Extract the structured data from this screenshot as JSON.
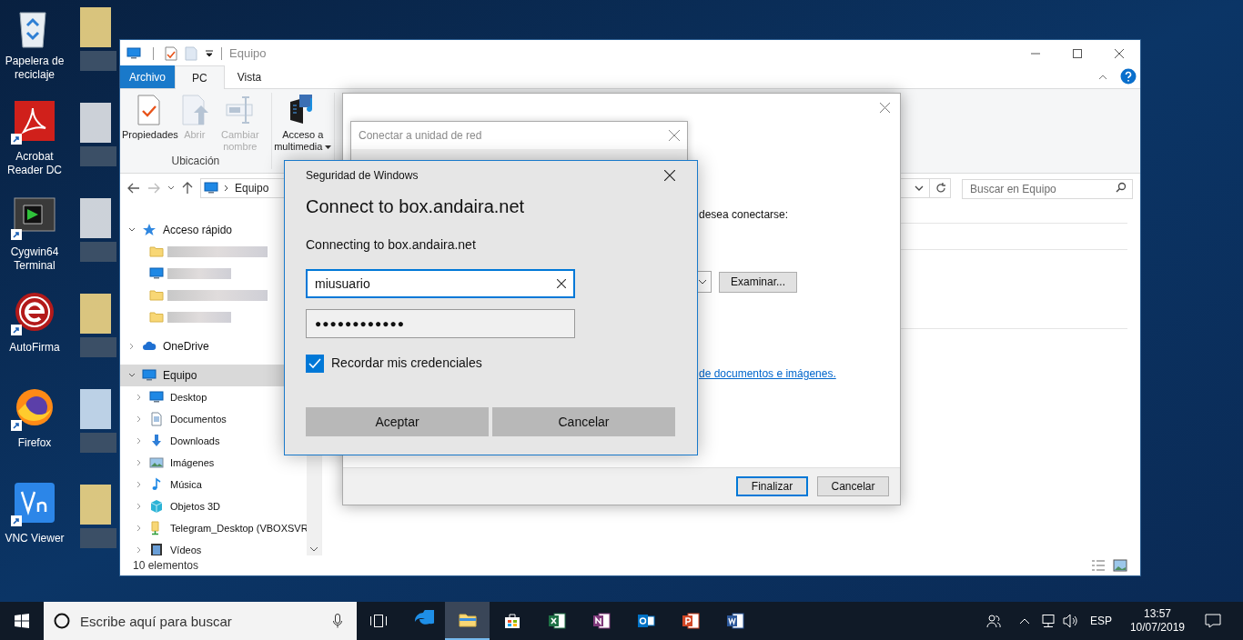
{
  "desktop_icons": [
    {
      "label": "Papelera de reciclaje",
      "kind": "recycle-bin"
    },
    {
      "label": "Acrobat Reader DC",
      "kind": "acrobat"
    },
    {
      "label": "Cygwin64 Terminal",
      "kind": "terminal"
    },
    {
      "label": "AutoFirma",
      "kind": "autofirma"
    },
    {
      "label": "Firefox",
      "kind": "firefox"
    },
    {
      "label": "VNC Viewer",
      "kind": "vnc"
    }
  ],
  "pixelated_icons": [
    {
      "kind": "folder"
    },
    {
      "kind": "document"
    },
    {
      "kind": "document"
    },
    {
      "kind": "folder"
    },
    {
      "kind": "image-document"
    },
    {
      "kind": "folder"
    }
  ],
  "explorer": {
    "title": "Equipo",
    "tabs": [
      {
        "label": "Archivo",
        "kind": "file",
        "selected": false
      },
      {
        "label": "PC",
        "kind": "tab",
        "selected": true
      },
      {
        "label": "Vista",
        "kind": "tab",
        "selected": false
      }
    ],
    "ribbon_groups": [
      {
        "label": "Ubicación",
        "buttons": [
          {
            "label": "Propiedades",
            "kind": "properties",
            "disabled": false,
            "dropdown": false
          },
          {
            "label": "Abrir",
            "kind": "open",
            "disabled": true,
            "dropdown": false
          },
          {
            "label": "Cambiar nombre",
            "kind": "rename",
            "disabled": true,
            "dropdown": false
          }
        ]
      },
      {
        "buttons": [
          {
            "label": "Acceso a multimedia",
            "kind": "media",
            "disabled": false,
            "dropdown": true
          }
        ]
      }
    ],
    "address": "Equipo",
    "search": {
      "placeholder": "Buscar en Equipo"
    },
    "nav_items": [
      {
        "label": "Acceso rápido",
        "kind": "star",
        "expanded": true,
        "selected": false,
        "children": [
          {
            "kind": "folder"
          },
          {
            "kind": "monitor"
          },
          {
            "kind": "folder"
          },
          {
            "kind": "folder"
          }
        ]
      },
      {
        "label": "OneDrive",
        "kind": "cloud",
        "expanded": false,
        "selected": false
      },
      {
        "label": "Equipo",
        "kind": "monitor",
        "expanded": true,
        "selected": true,
        "children": [
          {
            "label": "Desktop",
            "kind": "monitor",
            "expanded": false,
            "selected": false
          },
          {
            "label": "Documentos",
            "kind": "document",
            "expanded": false,
            "selected": false
          },
          {
            "label": "Downloads",
            "kind": "download",
            "expanded": false,
            "selected": false
          },
          {
            "label": "Imágenes",
            "kind": "image",
            "expanded": false,
            "selected": false
          },
          {
            "label": "Música",
            "kind": "music",
            "expanded": false,
            "selected": false
          },
          {
            "label": "Objetos 3D",
            "kind": "cube",
            "expanded": false,
            "selected": false
          },
          {
            "label": "Telegram_Desktop (VBOXSVR",
            "kind": "netfolder",
            "expanded": false,
            "selected": false
          },
          {
            "label": "Vídeos",
            "kind": "video",
            "expanded": false,
            "selected": false
          }
        ]
      }
    ],
    "status_bar": "10 elementos"
  },
  "map_drive_wizard": {
    "prompt": "desea conectarse:",
    "browse_button": "Examinar...",
    "link": "de documentos e imágenes.",
    "buttons": [
      {
        "label": "Finalizar",
        "default": true
      },
      {
        "label": "Cancelar",
        "default": false
      }
    ]
  },
  "connect_window": {
    "title": "Conectar a unidad de red"
  },
  "credential_dialog": {
    "title": "Seguridad de Windows",
    "heading": "Connect to box.andaira.net",
    "subtitle": "Connecting to box.andaira.net",
    "username": "miusuario",
    "password": "●●●●●●●●●●●●",
    "remember": {
      "label": "Recordar mis credenciales",
      "checked": true
    },
    "buttons": [
      "Aceptar",
      "Cancelar"
    ]
  },
  "taskbar": {
    "search_placeholder": "Escribe aquí para buscar",
    "apps": [
      {
        "kind": "edge",
        "selected": false
      },
      {
        "kind": "explorer",
        "selected": true
      },
      {
        "kind": "store",
        "selected": false
      },
      {
        "kind": "excel",
        "selected": false
      },
      {
        "kind": "onenote",
        "selected": false
      },
      {
        "kind": "outlook",
        "selected": false
      },
      {
        "kind": "powerpoint",
        "selected": false
      },
      {
        "kind": "word",
        "selected": false
      }
    ],
    "language": "ESP",
    "time": "13:57",
    "date": "10/07/2019"
  }
}
